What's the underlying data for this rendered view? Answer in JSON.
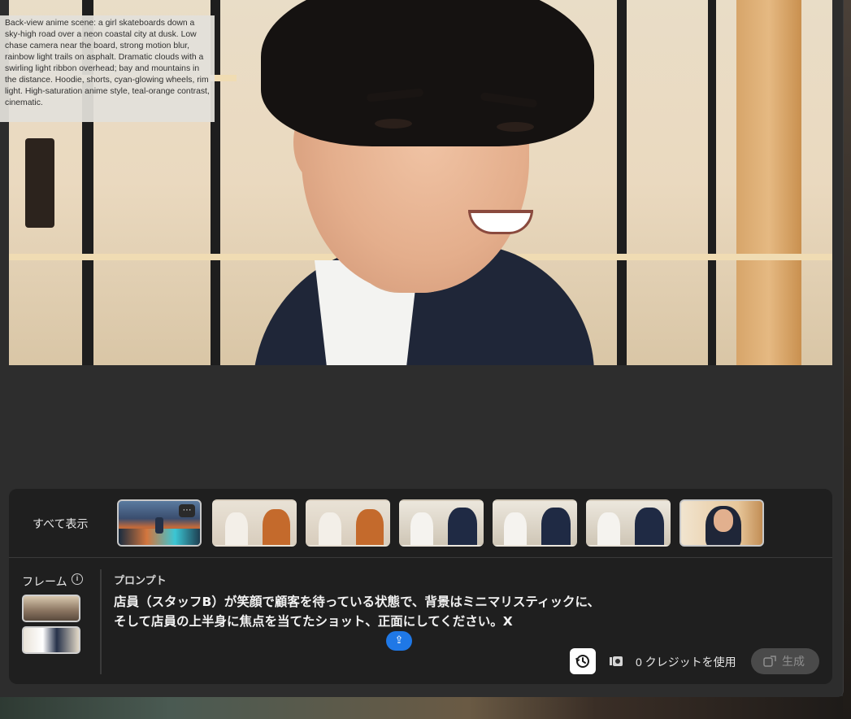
{
  "tooltip": {
    "text": "Back-view anime scene: a girl skateboards down a sky-high road over a neon coastal city at dusk. Low chase camera near the board, strong motion blur, rainbow light trails on asphalt. Dramatic clouds with a swirling light ribbon overhead; bay and mountains in the distance. Hoodie, shorts, cyan-glowing wheels, rim light. High-saturation anime style, teal-orange contrast, cinematic."
  },
  "thumbnail_strip": {
    "show_all_label": "すべて表示",
    "more_label": "···",
    "items": [
      {
        "kind": "anime-night-scene",
        "selected": true
      },
      {
        "kind": "store-couple-orange-jacket",
        "selected": false
      },
      {
        "kind": "store-couple-orange-jacket",
        "selected": false
      },
      {
        "kind": "store-couple-navy-suit",
        "selected": false
      },
      {
        "kind": "store-couple-navy-suit",
        "selected": false
      },
      {
        "kind": "store-couple-navy-suit",
        "selected": false
      },
      {
        "kind": "staff-portrait",
        "selected": true
      }
    ]
  },
  "frames": {
    "label": "フレーム",
    "info_icon": "info-icon",
    "items": [
      {
        "kind": "store-interior-group"
      },
      {
        "kind": "store-couple-suit"
      }
    ]
  },
  "prompt": {
    "label": "プロンプト",
    "text_line1": "店員（スタッフB）が笑顔で顧客を待っている状態で、背景はミニマリスティックに、",
    "text_line2": "そして店員の上半身に焦点を当てたショット、正面にしてください。X",
    "upload_icon": "upload-arrow-icon"
  },
  "toolbar": {
    "history_icon": "history-icon",
    "credits_icon": "credits-icon",
    "credits_label": "0 クレジットを使用",
    "generate_label": "生成",
    "generate_icon": "generate-icon"
  },
  "colors": {
    "panel_bg": "#2d2d2d",
    "dock_bg": "#1f1f1f",
    "accent_blue": "#1f78e6",
    "generate_disabled": "#4a4a4a"
  }
}
